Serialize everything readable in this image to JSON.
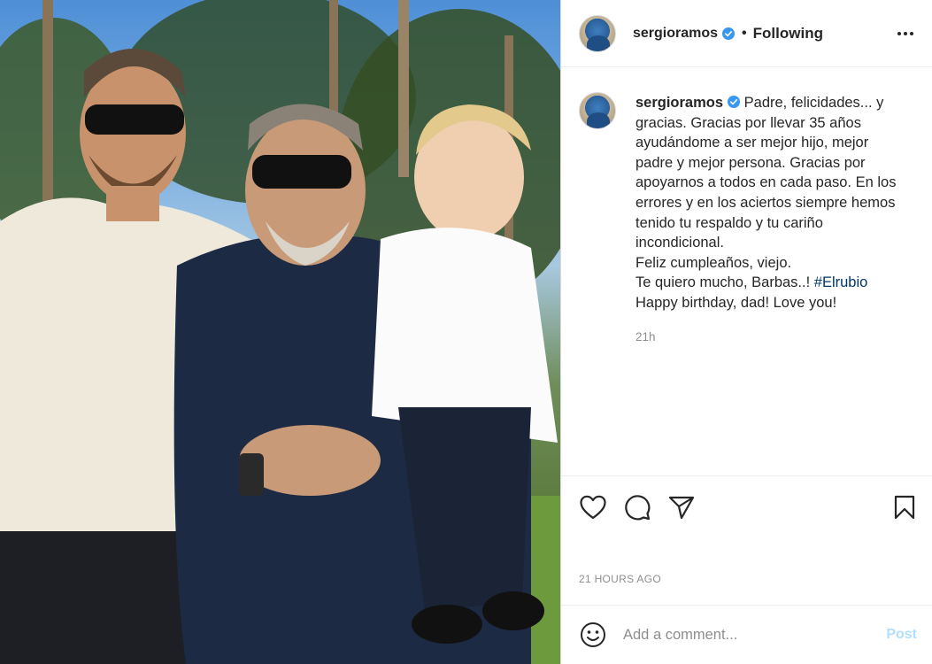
{
  "post": {
    "photo_icon": "photo-of-three-people"
  },
  "header": {
    "username": "sergioramos",
    "separator": "•",
    "follow_state": "Following",
    "more_icon": "more-horizontal-icon",
    "verified_icon": "verified-badge-icon"
  },
  "caption": {
    "username": "sergioramos",
    "lines": [
      "Padre, felicidades... y",
      "gracias. Gracias por llevar 35 años",
      "ayudándome a ser mejor hijo, mejor",
      "padre y mejor persona. Gracias por",
      "apoyarnos a todos en cada paso. En los",
      "errores y en los aciertos siempre hemos",
      "tenido tu respaldo y tu cariño",
      "incondicional.",
      "Feliz cumpleaños, viejo.",
      "Te quiero mucho, Barbas..! ",
      "Happy birthday, dad! Love you!"
    ],
    "hashtag": "#Elrubio",
    "time_ago": "21h"
  },
  "actions": {
    "like_icon": "heart-icon",
    "comment_icon": "comment-icon",
    "share_icon": "paper-plane-icon",
    "save_icon": "bookmark-icon"
  },
  "timestamp": "21 HOURS AGO",
  "comment_bar": {
    "emoji_icon": "smiley-icon",
    "placeholder": "Add a comment...",
    "post_label": "Post"
  },
  "colors": {
    "verified": "#3897f0",
    "hashtag": "#00376b",
    "muted": "#8e8e8e",
    "post_disabled": "#b2dffc"
  }
}
